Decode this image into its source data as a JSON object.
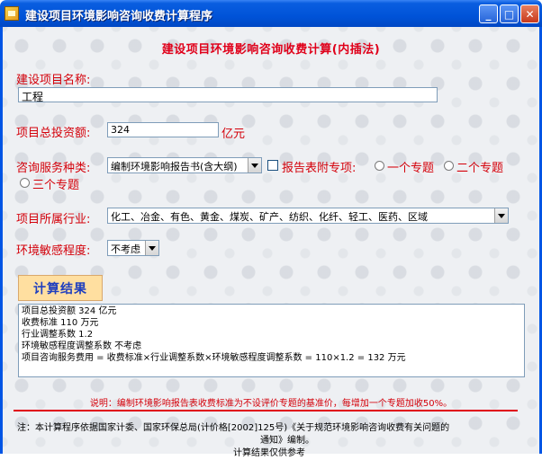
{
  "window": {
    "title": "建设项目环境影响咨询收费计算程序",
    "min_glyph": "_",
    "max_glyph": "□",
    "close_glyph": "✕"
  },
  "heading": "建设项目环境影响咨询收费计算(内插法)",
  "project_name": {
    "label": "建设项目名称:",
    "value": "工程"
  },
  "investment": {
    "label": "项目总投资额:",
    "value": "324",
    "unit": "亿元"
  },
  "service": {
    "label": "咨询服务种类:",
    "selected": "编制环境影响报告书(含大纲)",
    "checkbox_label": "报告表附专项:",
    "radios": [
      "一个专题",
      "二个专题",
      "三个专题"
    ]
  },
  "industry": {
    "label": "项目所属行业:",
    "selected": "化工、冶金、有色、黄金、煤炭、矿产、纺织、化纤、轻工、医药、区域"
  },
  "sensitivity": {
    "label": "环境敏感程度:",
    "selected": "不考虑"
  },
  "calc_button": "计算结果",
  "result_lines": [
    "项目总投资额 324 亿元",
    "收费标准 110 万元",
    "行业调整系数 1.2",
    "环境敏感程度调整系数 不考虑",
    "项目咨询服务费用 = 收费标准×行业调整系数×环境敏感程度调整系数 = 110×1.2 = 132 万元"
  ],
  "note": "说明：编制环境影响报告表收费标准为不设评价专题的基准价，每增加一个专题加收50%。",
  "footer": {
    "line1": "注：本计算程序依据国家计委、国家环保总局(计价格[2002]125号)《关于规范环境影响咨询收费有关问题的",
    "line2": "通知》编制。",
    "line3": "计算结果仅供参考"
  }
}
